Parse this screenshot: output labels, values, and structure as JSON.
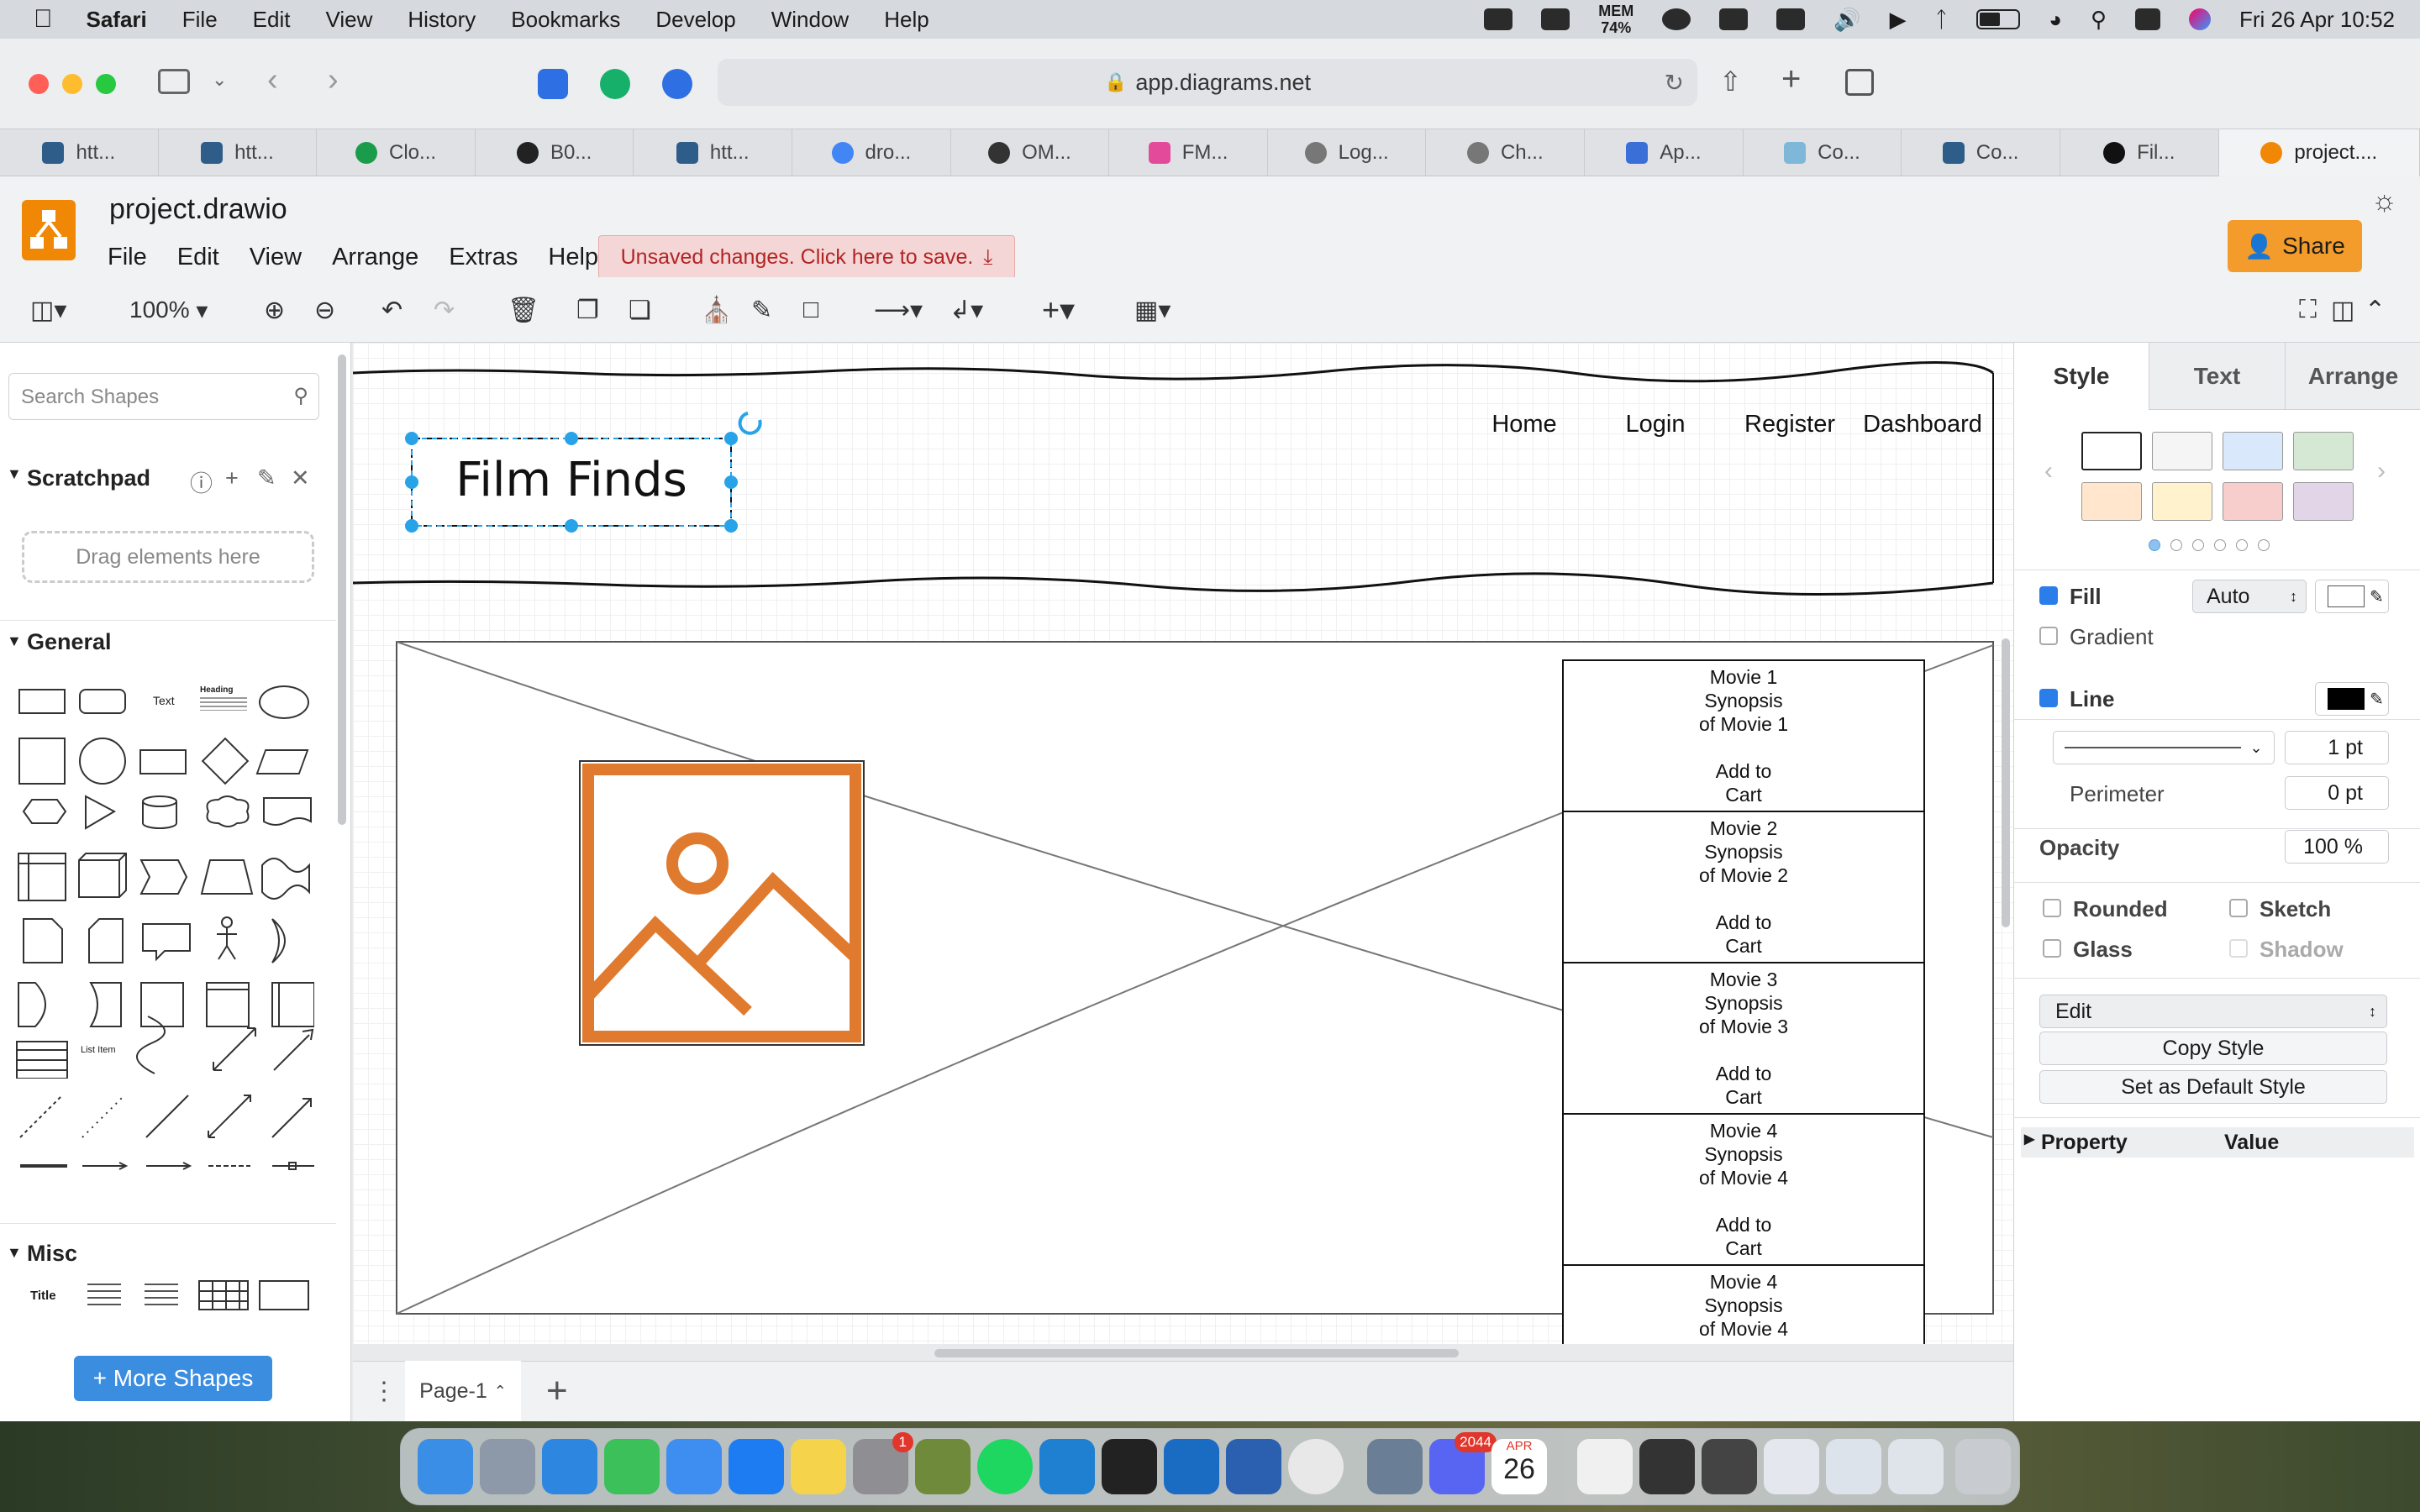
{
  "menubar": {
    "app": "Safari",
    "items": [
      "File",
      "Edit",
      "View",
      "History",
      "Bookmarks",
      "Develop",
      "Window",
      "Help"
    ],
    "mem_label": "MEM",
    "mem_value": "74%",
    "datetime": "Fri 26 Apr  10:52"
  },
  "safari": {
    "url": "app.diagrams.net",
    "tabs": [
      "htt...",
      "htt...",
      "Clo...",
      "B0...",
      "htt...",
      "dro...",
      "OM...",
      "FM...",
      "Log...",
      "Ch...",
      "Ap...",
      "Co...",
      "Co...",
      "Fil...",
      "project...."
    ]
  },
  "drawio": {
    "doc_name": "project.drawio",
    "menu": [
      "File",
      "Edit",
      "View",
      "Arrange",
      "Extras",
      "Help"
    ],
    "unsaved_text": "Unsaved changes. Click here to save.",
    "share_label": "Share",
    "zoom": "100%"
  },
  "left_panel": {
    "search_placeholder": "Search Shapes",
    "scratchpad": "Scratchpad",
    "drag_hint": "Drag elements here",
    "general": "General",
    "misc": "Misc",
    "shape_text": "Text",
    "shape_heading": "Heading",
    "list_item": "List Item",
    "misc_title": "Title",
    "more_shapes": "+ More Shapes"
  },
  "canvas": {
    "logo_text": "Film Finds",
    "nav": [
      "Home",
      "Login",
      "Register",
      "Dashboard"
    ],
    "movies": [
      {
        "lines": [
          "Movie 1",
          "Synopsis",
          "of Movie 1",
          "",
          "Add to",
          "Cart"
        ]
      },
      {
        "lines": [
          "Movie 2",
          "Synopsis",
          "of Movie 2",
          "",
          "Add to",
          "Cart"
        ]
      },
      {
        "lines": [
          "Movie 3",
          "Synopsis",
          "of Movie 3",
          "",
          "Add to",
          "Cart"
        ]
      },
      {
        "lines": [
          "Movie 4",
          "Synopsis",
          "of Movie 4",
          "",
          "Add to",
          "Cart"
        ]
      },
      {
        "lines": [
          "Movie 4",
          "Synopsis",
          "of Movie 4"
        ]
      }
    ],
    "page_tab": "Page-1"
  },
  "right_panel": {
    "tabs": [
      "Style",
      "Text",
      "Arrange"
    ],
    "fill_label": "Fill",
    "fill_value": "Auto",
    "gradient_label": "Gradient",
    "line_label": "Line",
    "line_width": "1 pt",
    "perimeter_label": "Perimeter",
    "perimeter_value": "0 pt",
    "opacity_label": "Opacity",
    "opacity_value": "100 %",
    "rounded": "Rounded",
    "sketch": "Sketch",
    "glass": "Glass",
    "shadow": "Shadow",
    "edit_select": "Edit",
    "copy_style": "Copy Style",
    "set_default": "Set as Default Style",
    "property": "Property",
    "value": "Value",
    "swatch_colors": [
      "#ffffff",
      "#f5f5f5",
      "#dae8fc",
      "#d5e8d4",
      "#ffe6cc",
      "#fff2cc",
      "#f8cecc",
      "#e1d5e7"
    ]
  },
  "dock": {
    "badge_settings": "1",
    "badge_discord": "2044",
    "calendar_month": "APR",
    "calendar_day": "26"
  },
  "colors": {
    "accent": "#f08705",
    "image_icon": "#e07a2e",
    "selection": "#29a3e8",
    "unsaved_red": "#b32424"
  }
}
